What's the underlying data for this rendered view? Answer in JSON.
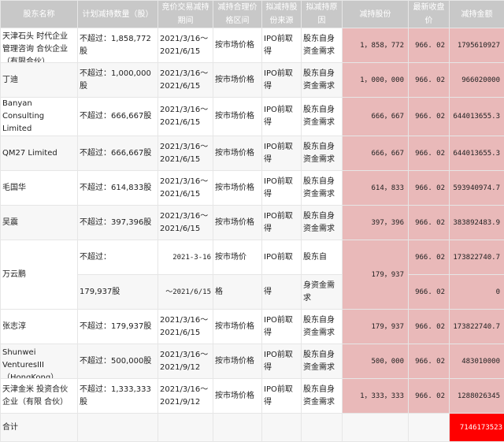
{
  "headers": [
    "股东名称",
    "计划减持数量（股）",
    "竞价交易减持期间",
    "减持合理价格区间",
    "拟减持股份来源",
    "拟减持原因",
    "减持股份",
    "最新收盘价",
    "减持金额"
  ],
  "rows": [
    {
      "name": "天津石头 时代企业管理咨询 合伙企业（有限合伙）",
      "qty": "不超过：1,858,772股",
      "period": "2021/3/16～2021/6/15",
      "price_range": "按市场价格",
      "source": "IPO前取得",
      "reason": "股东自身资金需求",
      "shares": "1，858，772",
      "close": "966. 02",
      "amount": "1795610927"
    },
    {
      "name": "丁迪",
      "qty": "不超过：1,000,000股",
      "period": "2021/3/16～2021/6/15",
      "price_range": "按市场价格",
      "source": "IPO前取得",
      "reason": "股东自身资金需求",
      "shares": "1，000，000",
      "close": "966. 02",
      "amount": "966020000"
    },
    {
      "name": "Banyan Consulting Limited",
      "qty": "不超过：666,667股",
      "period": "2021/3/16～2021/6/15",
      "price_range": "按市场价格",
      "source": "IPO前取得",
      "reason": "股东自身资金需求",
      "shares": "666，667",
      "close": "966. 02",
      "amount": "644013655.3"
    },
    {
      "name": "QM27 Limited",
      "qty": "不超过：666,667股",
      "period": "2021/3/16～2021/6/15",
      "price_range": "按市场价格",
      "source": "IPO前取得",
      "reason": "股东自身资金需求",
      "shares": "666，667",
      "close": "966. 02",
      "amount": "644013655.3"
    },
    {
      "name": "毛国华",
      "qty": "不超过：614,833股",
      "period": "2021/3/16～2021/6/15",
      "price_range": "按市场价格",
      "source": "IPO前取得",
      "reason": "股东自身资金需求",
      "shares": "614，833",
      "close": "966. 02",
      "amount": "593940974.7"
    },
    {
      "name": "吴震",
      "qty": "不超过：397,396股",
      "period": "2021/3/16～2021/6/15",
      "price_range": "按市场价格",
      "source": "IPO前取得",
      "reason": "股东自身资金需求",
      "shares": "397，396",
      "close": "966. 02",
      "amount": "383892483.9"
    }
  ],
  "wan": {
    "name": "万云鹏",
    "qty_a": "不超过：",
    "period_a": "2021-3-16",
    "price_a": "按市场价",
    "source_a": "IPO前取",
    "reason_a": "股东自",
    "close_a": "966. 02",
    "amount_a": "173822740.7",
    "shares": "179，937",
    "qty_b": "179,937股",
    "period_b": "～2021/6/15",
    "price_b": "格",
    "source_b": "得",
    "reason_b": "身资金需求",
    "close_b": "966. 02",
    "amount_b": "0"
  },
  "rows2": [
    {
      "name": "张志淳",
      "qty": "不超过：179,937股",
      "period": "2021/3/16～2021/6/15",
      "price_range": "按市场价格",
      "source": "IPO前取得",
      "reason": "股东自身资金需求",
      "shares": "179，937",
      "close": "966. 02",
      "amount": "173822740.7"
    },
    {
      "name": "Shunwei VenturesIII（HongKong）",
      "qty": "不超过：500,000股",
      "period": "2021/3/16～2021/9/12",
      "price_range": "按市场价格",
      "source": "IPO前取得",
      "reason": "股东自身资金需求",
      "shares": "500，000",
      "close": "966. 02",
      "amount": "483010000"
    },
    {
      "name": "天津金米 投资合伙企业（有限 合伙）",
      "qty": "不超过：1,333,333股",
      "period": "2021/3/16～2021/9/12",
      "price_range": "按市场价格",
      "source": "IPO前取得",
      "reason": "股东自身资金需求",
      "shares": "1，333，333",
      "close": "966. 02",
      "amount": "1288026345"
    }
  ],
  "total": {
    "label": "合计",
    "amount": "7146173523"
  },
  "colors": {
    "header_bg": "#c8c8c8",
    "highlight": "#e9b9b9",
    "total_red": "#ff0000"
  }
}
